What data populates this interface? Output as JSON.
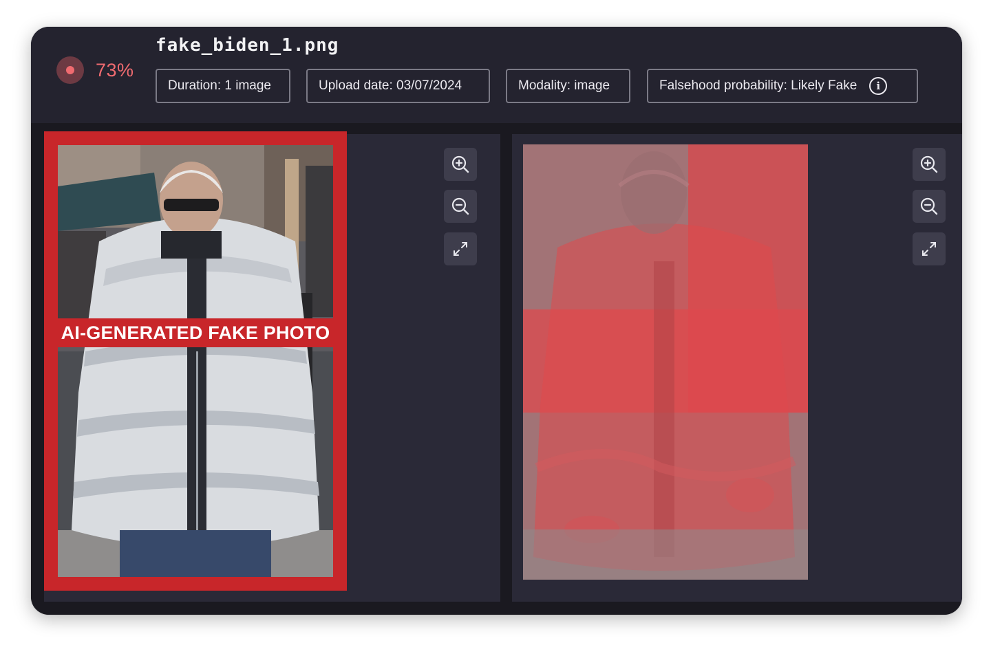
{
  "header": {
    "score": "73%",
    "file_name": "fake_biden_1.png",
    "chips": {
      "duration": "Duration: 1 image",
      "upload_date": "Upload date: 03/07/2024",
      "modality": "Modality: image",
      "falsehood": "Falsehood probability: Likely Fake"
    }
  },
  "left_panel": {
    "banner_text": "AI-GENERATED FAKE PHOTO"
  },
  "icons": {
    "status": "record-dot-icon",
    "info": "info-icon",
    "zoom_in": "zoom-in-icon",
    "zoom_out": "zoom-out-icon",
    "expand": "expand-icon"
  },
  "colors": {
    "accent": "#f06b70",
    "frame_red": "#c8262a",
    "window_bg": "#24232f",
    "panel_bg": "#2a2937"
  }
}
